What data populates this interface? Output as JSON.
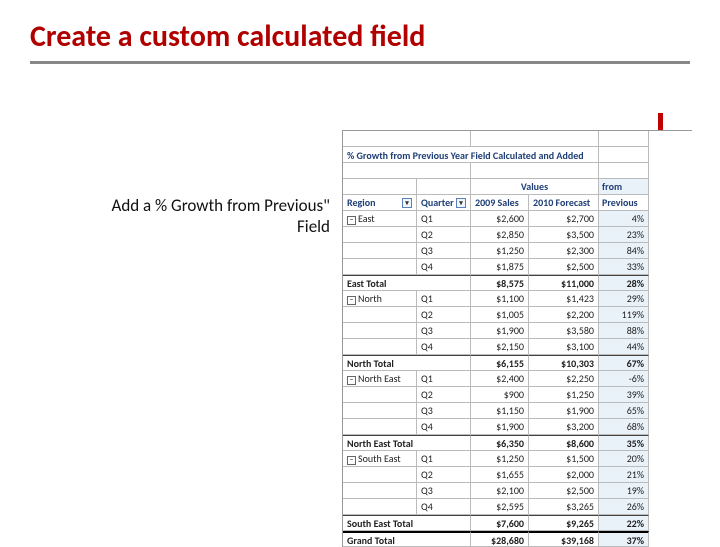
{
  "title": "Create a custom calculated field",
  "caption": "Add a % Growth from Previous\" Field",
  "pivot": {
    "banner": "% Growth from Previous Year Field Calculated and Added",
    "values_label": "Values",
    "headers": {
      "region": "Region",
      "quarter": "Quarter",
      "sales09": "2009 Sales",
      "forecast10": "2010 Forecast",
      "growth_top": "from",
      "growth_bottom": "Previous"
    },
    "groups": [
      {
        "region": "East",
        "rows": [
          {
            "q": "Q1",
            "s09": "$2,600",
            "s10": "$2,700",
            "g": "4%"
          },
          {
            "q": "Q2",
            "s09": "$2,850",
            "s10": "$3,500",
            "g": "23%"
          },
          {
            "q": "Q3",
            "s09": "$1,250",
            "s10": "$2,300",
            "g": "84%"
          },
          {
            "q": "Q4",
            "s09": "$1,875",
            "s10": "$2,500",
            "g": "33%"
          }
        ],
        "total_label": "East Total",
        "total": {
          "s09": "$8,575",
          "s10": "$11,000",
          "g": "28%"
        }
      },
      {
        "region": "North",
        "rows": [
          {
            "q": "Q1",
            "s09": "$1,100",
            "s10": "$1,423",
            "g": "29%"
          },
          {
            "q": "Q2",
            "s09": "$1,005",
            "s10": "$2,200",
            "g": "119%"
          },
          {
            "q": "Q3",
            "s09": "$1,900",
            "s10": "$3,580",
            "g": "88%"
          },
          {
            "q": "Q4",
            "s09": "$2,150",
            "s10": "$3,100",
            "g": "44%"
          }
        ],
        "total_label": "North Total",
        "total": {
          "s09": "$6,155",
          "s10": "$10,303",
          "g": "67%"
        }
      },
      {
        "region": "North East",
        "rows": [
          {
            "q": "Q1",
            "s09": "$2,400",
            "s10": "$2,250",
            "g": "-6%"
          },
          {
            "q": "Q2",
            "s09": "$900",
            "s10": "$1,250",
            "g": "39%"
          },
          {
            "q": "Q3",
            "s09": "$1,150",
            "s10": "$1,900",
            "g": "65%"
          },
          {
            "q": "Q4",
            "s09": "$1,900",
            "s10": "$3,200",
            "g": "68%"
          }
        ],
        "total_label": "North East Total",
        "total": {
          "s09": "$6,350",
          "s10": "$8,600",
          "g": "35%"
        }
      },
      {
        "region": "South East",
        "rows": [
          {
            "q": "Q1",
            "s09": "$1,250",
            "s10": "$1,500",
            "g": "20%"
          },
          {
            "q": "Q2",
            "s09": "$1,655",
            "s10": "$2,000",
            "g": "21%"
          },
          {
            "q": "Q3",
            "s09": "$2,100",
            "s10": "$2,500",
            "g": "19%"
          },
          {
            "q": "Q4",
            "s09": "$2,595",
            "s10": "$3,265",
            "g": "26%"
          }
        ],
        "total_label": "South East Total",
        "total": {
          "s09": "$7,600",
          "s10": "$9,265",
          "g": "22%"
        }
      }
    ],
    "grand": {
      "label": "Grand Total",
      "s09": "$28,680",
      "s10": "$39,168",
      "g": "37%"
    }
  }
}
